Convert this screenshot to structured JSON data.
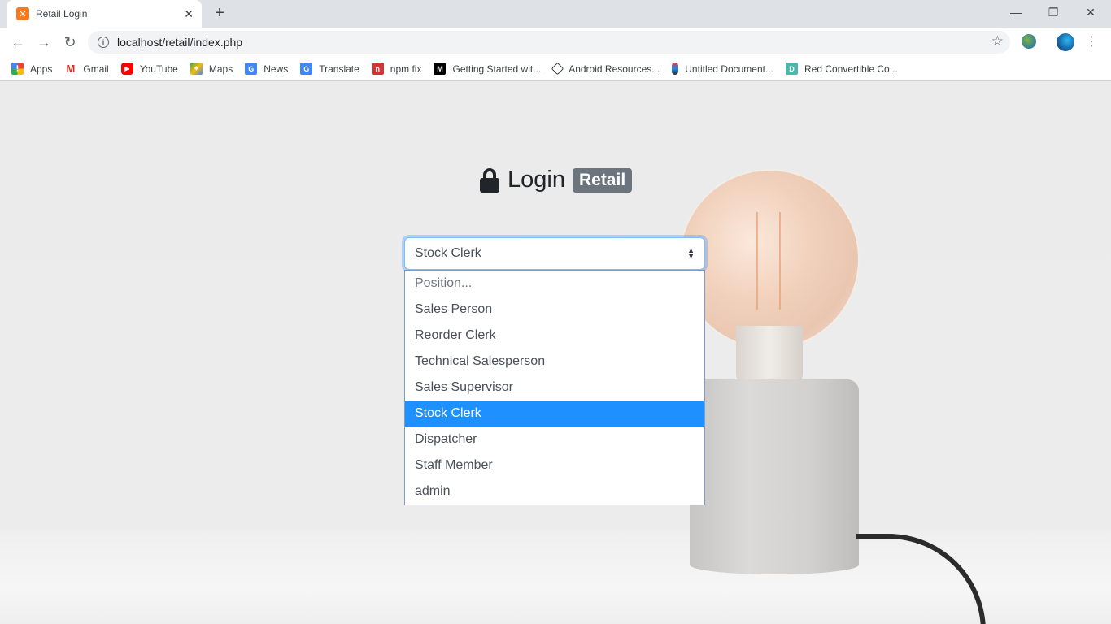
{
  "browser": {
    "tab": {
      "title": "Retail Login",
      "favicon": "xampp-icon"
    },
    "new_tab_label": "+",
    "window_controls": {
      "minimize": "—",
      "restore": "❐",
      "close": "✕"
    },
    "nav": {
      "back": "←",
      "forward": "→",
      "reload": "↻"
    },
    "address": "localhost/retail/index.php",
    "menu": "⋮",
    "bookmarks": [
      {
        "label": "Apps",
        "icon": "apps-grid-icon",
        "color": "#e94235"
      },
      {
        "label": "Gmail",
        "icon": "gmail-icon",
        "color": "#d93025"
      },
      {
        "label": "YouTube",
        "icon": "youtube-icon",
        "color": "#ff0000"
      },
      {
        "label": "Maps",
        "icon": "maps-icon",
        "color": "#34a853"
      },
      {
        "label": "News",
        "icon": "news-icon",
        "color": "#4285f4"
      },
      {
        "label": "Translate",
        "icon": "translate-icon",
        "color": "#4285f4"
      },
      {
        "label": "npm fix",
        "icon": "npm-icon",
        "color": "#cb3837"
      },
      {
        "label": "Getting Started wit...",
        "icon": "medium-icon",
        "color": "#000000"
      },
      {
        "label": "Android Resources...",
        "icon": "android-icon",
        "color": "#3ddc84"
      },
      {
        "label": "Untitled Document...",
        "icon": "document-icon",
        "color": "#7b4a2a"
      },
      {
        "label": "Red Convertible Co...",
        "icon": "doc-d-icon",
        "color": "#4db6ac"
      }
    ]
  },
  "login": {
    "title": "Login",
    "badge": "Retail",
    "position_select": {
      "value": "Stock Clerk",
      "options": [
        "Position...",
        "Sales Person",
        "Reorder Clerk",
        "Technical Salesperson",
        "Sales Supervisor",
        "Stock Clerk",
        "Dispatcher",
        "Staff Member",
        "admin"
      ],
      "selected_index": 5
    }
  },
  "colors": {
    "accent_focus": "#80bdff",
    "selected_option_bg": "#1e90ff",
    "badge_bg": "#6c757d"
  }
}
